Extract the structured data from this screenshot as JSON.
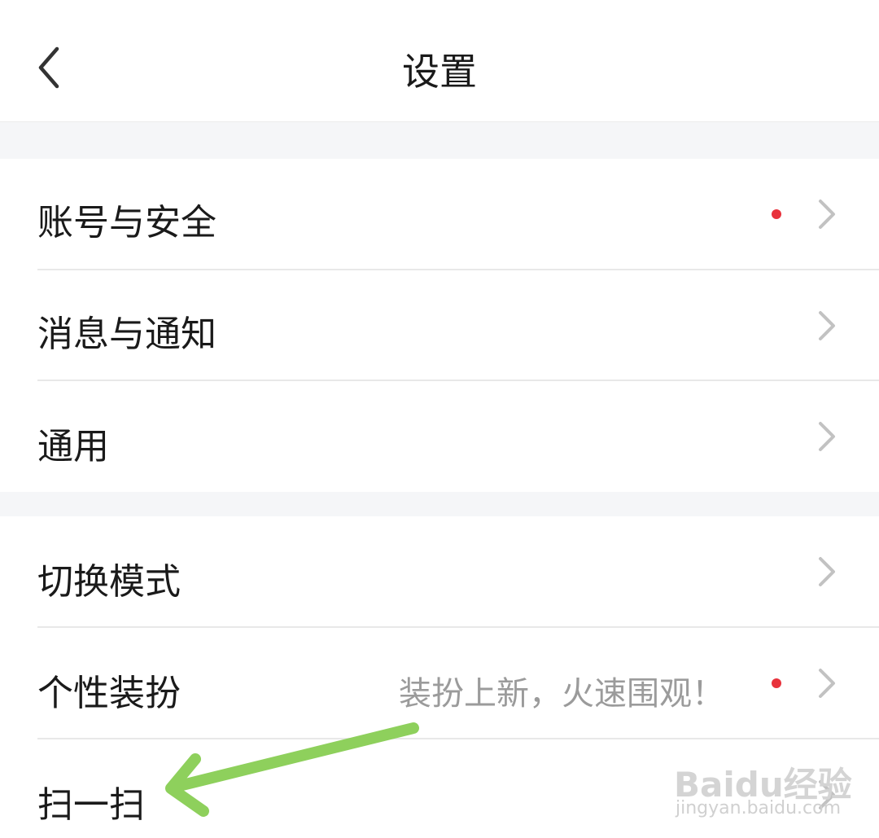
{
  "header": {
    "title": "设置"
  },
  "groups": [
    {
      "items": [
        {
          "label": "账号与安全",
          "badge": true
        },
        {
          "label": "消息与通知",
          "badge": false
        },
        {
          "label": "通用",
          "badge": false
        }
      ]
    },
    {
      "items": [
        {
          "label": "切换模式",
          "badge": false
        },
        {
          "label": "个性装扮",
          "hint": "装扮上新，火速围观！",
          "badge": true
        },
        {
          "label": "扫一扫",
          "badge": false
        }
      ]
    }
  ],
  "watermark": {
    "text": "Baidu经验",
    "sub": "jingyan.baidu.com"
  },
  "colors": {
    "badge": "#e8323c",
    "arrow": "#8ed05c",
    "divider": "#e8e8e8",
    "section_gap": "#f5f6f8"
  }
}
